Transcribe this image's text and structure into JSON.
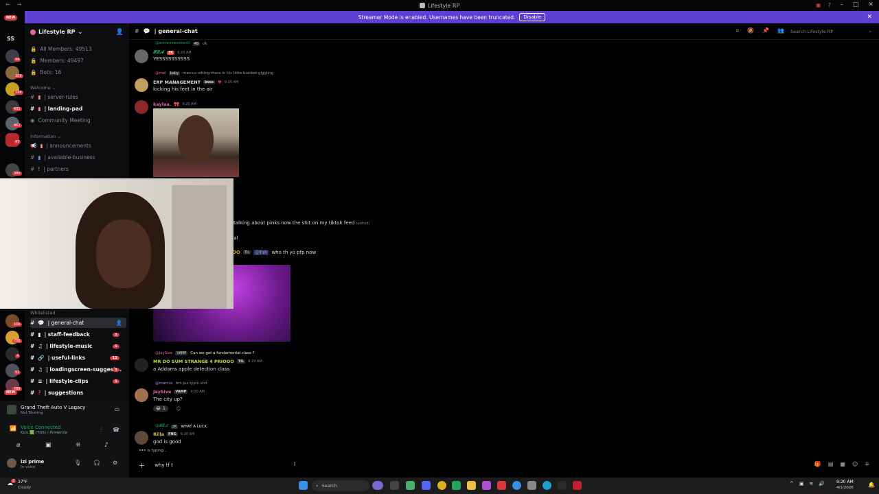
{
  "window": {
    "title": "Lifestyle RP"
  },
  "banner": {
    "text": "Streamer Mode is enabled. Usernames have been truncated.",
    "button": "Disable"
  },
  "servers": {
    "new_top": "NEW",
    "new_bottom": "NEW",
    "dm_initials": "SS",
    "badges": [
      "6",
      "44",
      "309",
      "198",
      "431",
      "462",
      "47",
      "380",
      "106",
      "798",
      "4",
      "51",
      "788"
    ]
  },
  "sidebar": {
    "server_name": "Lifestyle RP",
    "stats": [
      "All Members: 49513",
      "Members: 49497",
      "Bots: 16"
    ],
    "cat_welcome": "Welcome",
    "cat_information": "Information",
    "cat_whitelisted": "Whitelisted",
    "welcome": [
      {
        "label": "| server-rules"
      },
      {
        "label": "| landing-pad"
      },
      {
        "label": "Community Meeting"
      }
    ],
    "information": [
      {
        "label": "| announcements"
      },
      {
        "label": "| available-business"
      },
      {
        "label": "| partners"
      }
    ],
    "whitelisted": [
      {
        "label": "| general-chat",
        "badge": ""
      },
      {
        "label": "| staff-feedback",
        "badge": "1"
      },
      {
        "label": "| lifestyle-music",
        "badge": "1"
      },
      {
        "label": "| useful-links",
        "badge": "12"
      },
      {
        "label": "| loadingscreen-suggest...",
        "badge": "1"
      },
      {
        "label": "| lifestyle-clips",
        "badge": "1"
      },
      {
        "label": "| suggestions",
        "badge": ""
      }
    ]
  },
  "activity": {
    "game": "Grand Theft Auto V Legacy",
    "status": "Not Sharing"
  },
  "voice": {
    "status": "Voice Connected",
    "channel": "Kick 🟩 (TOS) / 𝑃𝑟𝑖𝑚𝑒𝑉𝑖𝑙𝑙𝑒"
  },
  "user": {
    "name": "izi prime",
    "status": "In voice"
  },
  "channel": {
    "name": "| general-chat",
    "search_placeholder": "Search Lifestyle RP"
  },
  "messages": {
    "m1": {
      "reply_user": "@𝔞𝔪𝔦𝔯𝔦𝔞𝔪𝔦𝔯𝔦𝔞𝔪𝔦𝔯𝔦𝔞𝔪𝔦𝔯𝔦",
      "reply_tag": "48",
      "reply_text": "ok",
      "user": "𝓕𝓛𝓐",
      "tag": "2K",
      "time": "9:20 AM",
      "text": "YESSSSSSSSSS"
    },
    "m2": {
      "reply_user": "@mel",
      "reply_tag": "baby",
      "reply_text": "marcus sitting there in his little blanket giggling",
      "user": "ERP MANAGEMENT",
      "tag": "boss",
      "time": "9:20 AM",
      "text": "kicking his feet in the air"
    },
    "m3": {
      "user": "kaylaa.",
      "time": "9:20 AM"
    },
    "m4": {
      "text": "talking about pinks now the shit on my tiktok feed",
      "edited": "(edited)"
    },
    "m5": {
      "text": "eal"
    },
    "m6": {
      "user": "OO",
      "tag": "TIL",
      "mention": "@fah",
      "text": "who th yo pfp now"
    },
    "m7": {
      "reply_user": "@JaySive",
      "reply_tag": "VAMP",
      "reply_text": "Can we get a fundamental class ?",
      "user": "MR DO SUM STRANGE 4 PRIOOO",
      "tag": "TIL",
      "time": "9:20 AM",
      "text": "a Addams apple detection class"
    },
    "m8": {
      "reply_user": "@marcus",
      "reply_text": "bro jus typin shit",
      "user": "JaySive",
      "tag": "VAMP",
      "time": "9:20 AM",
      "text": "The city up?",
      "reaction": "1"
    },
    "m9": {
      "reply_user": "@𝓕𝓛𝓐",
      "reply_tag": "2K",
      "reply_text": "WHAT A LUCK",
      "user": "Rilla",
      "tag": "FNG",
      "time": "9:20 AM",
      "text": "god is good"
    }
  },
  "typing": "is typing...",
  "input": {
    "value": "why tf t"
  },
  "taskbar": {
    "weather_temp": "37°F",
    "weather_desc": "Cloudy",
    "search": "Search",
    "time": "9:20 AM",
    "date": "4/1/2026",
    "notif": "2"
  },
  "colors": {
    "accent": "#5d3fd3",
    "red": "#da373c",
    "green": "#23a55a"
  }
}
